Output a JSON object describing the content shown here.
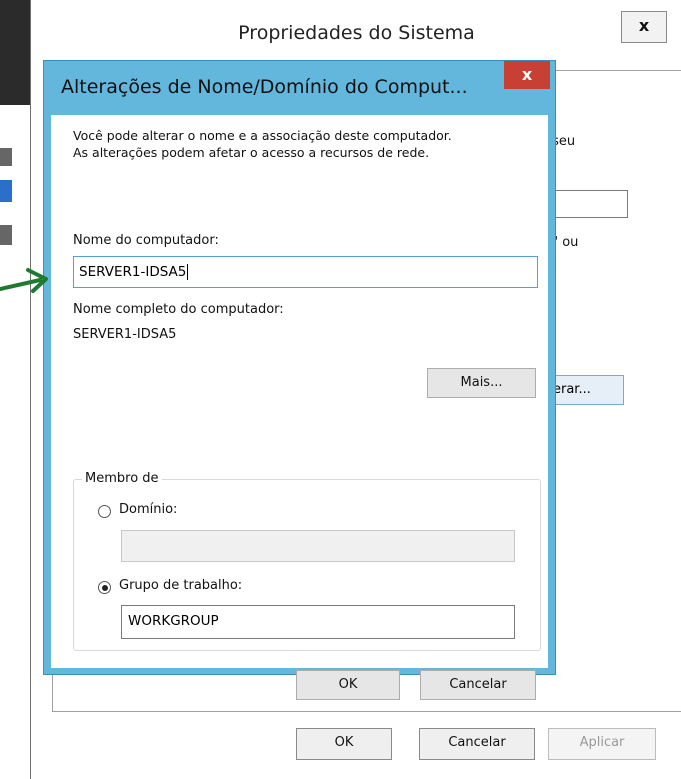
{
  "background_window": {
    "title": "Propriedades do Sistema",
    "close_label": "x",
    "partial_text_right_1": "o seu",
    "partial_text_right_2": "IS\" ou",
    "partial_button_label": "erar...",
    "ok_label": "OK",
    "cancel_label": "Cancelar",
    "apply_label": "Aplicar"
  },
  "dialog": {
    "title": "Alterações de Nome/Domínio do Comput...",
    "close_label": "x",
    "intro_line1": "Você pode alterar o nome e a associação deste computador.",
    "intro_line2": "As alterações podem afetar o acesso a recursos de rede.",
    "computer_name_label": "Nome do computador:",
    "computer_name_value": "SERVER1-IDSA5",
    "full_name_label": "Nome completo do computador:",
    "full_name_value": "SERVER1-IDSA5",
    "more_button": "Mais...",
    "member_of_label": "Membro de",
    "domain_label": "Domínio:",
    "domain_value": "",
    "domain_selected": false,
    "workgroup_label": "Grupo de trabalho:",
    "workgroup_value": "WORKGROUP",
    "workgroup_selected": true,
    "ok_label": "OK",
    "cancel_label": "Cancelar"
  },
  "annotation": {
    "arrow_color": "#1d7a2f",
    "arrow_icon": "arrow-right-icon"
  },
  "colors": {
    "dialog_frame": "#63b6dc",
    "close_button": "#c84033",
    "focus_border": "#569de5"
  }
}
